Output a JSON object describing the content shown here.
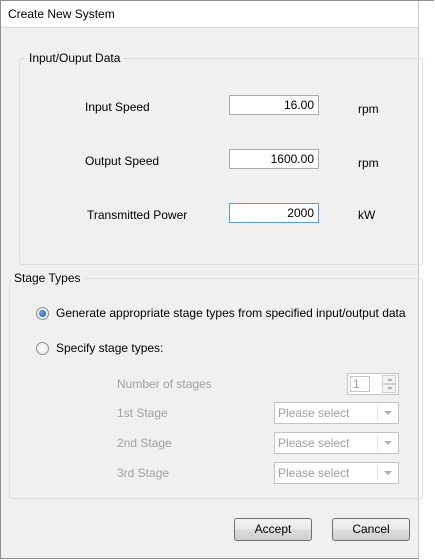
{
  "window": {
    "title": "Create New System"
  },
  "io_group": {
    "legend": "Input/Ouput Data",
    "fields": [
      {
        "label": "Input Speed",
        "value": "16.00",
        "unit": "rpm"
      },
      {
        "label": "Output Speed",
        "value": "1600.00",
        "unit": "rpm"
      },
      {
        "label": "Transmitted Power",
        "value": "2000",
        "unit": "kW"
      }
    ]
  },
  "stage_group": {
    "legend": "Stage Types",
    "options": [
      {
        "label": "Generate appropriate stage types from specified input/output data",
        "checked": true
      },
      {
        "label": "Specify stage types:",
        "checked": false
      }
    ],
    "num_stages_label": "Number of stages",
    "num_stages_value": "1",
    "stages": [
      {
        "label": "1st Stage",
        "value": "Please select"
      },
      {
        "label": "2nd Stage",
        "value": "Please select"
      },
      {
        "label": "3rd Stage",
        "value": "Please select"
      }
    ]
  },
  "buttons": {
    "accept": "Accept",
    "cancel": "Cancel"
  }
}
